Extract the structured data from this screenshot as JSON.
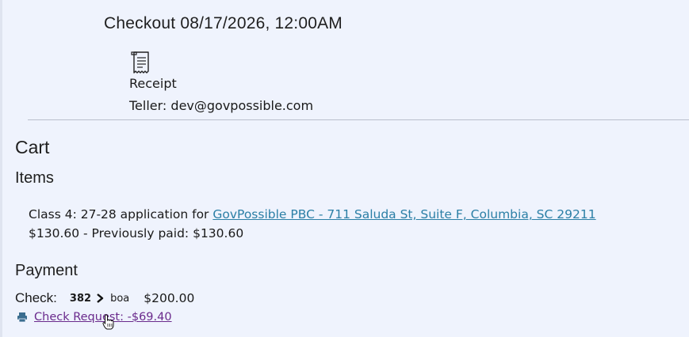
{
  "checkout": {
    "title": "Checkout 08/17/2026, 12:00AM",
    "receipt_label": "Receipt",
    "teller": "Teller: dev@govpossible.com"
  },
  "cart": {
    "heading": "Cart",
    "items_heading": "Items",
    "item": {
      "description": "Class 4: 27-28 application for ",
      "link_text": "GovPossible PBC - 711 Saluda St, Suite F, Columbia, SC 29211",
      "amount_line": "$130.60 - Previously paid: $130.60"
    },
    "payment_heading": "Payment",
    "check": {
      "label": "Check:",
      "number": "382",
      "bank": "boa",
      "amount": "$200.00"
    },
    "check_request": "Check Request: -$69.40"
  },
  "icons": {
    "receipt": "receipt-icon",
    "printer": "printer-icon",
    "chevron": "chevron-right-icon",
    "cursor": "hand-cursor-icon"
  },
  "colors": {
    "background": "#eff3fd",
    "link": "#2b7fa6",
    "visited_link": "#6a2a8c"
  }
}
